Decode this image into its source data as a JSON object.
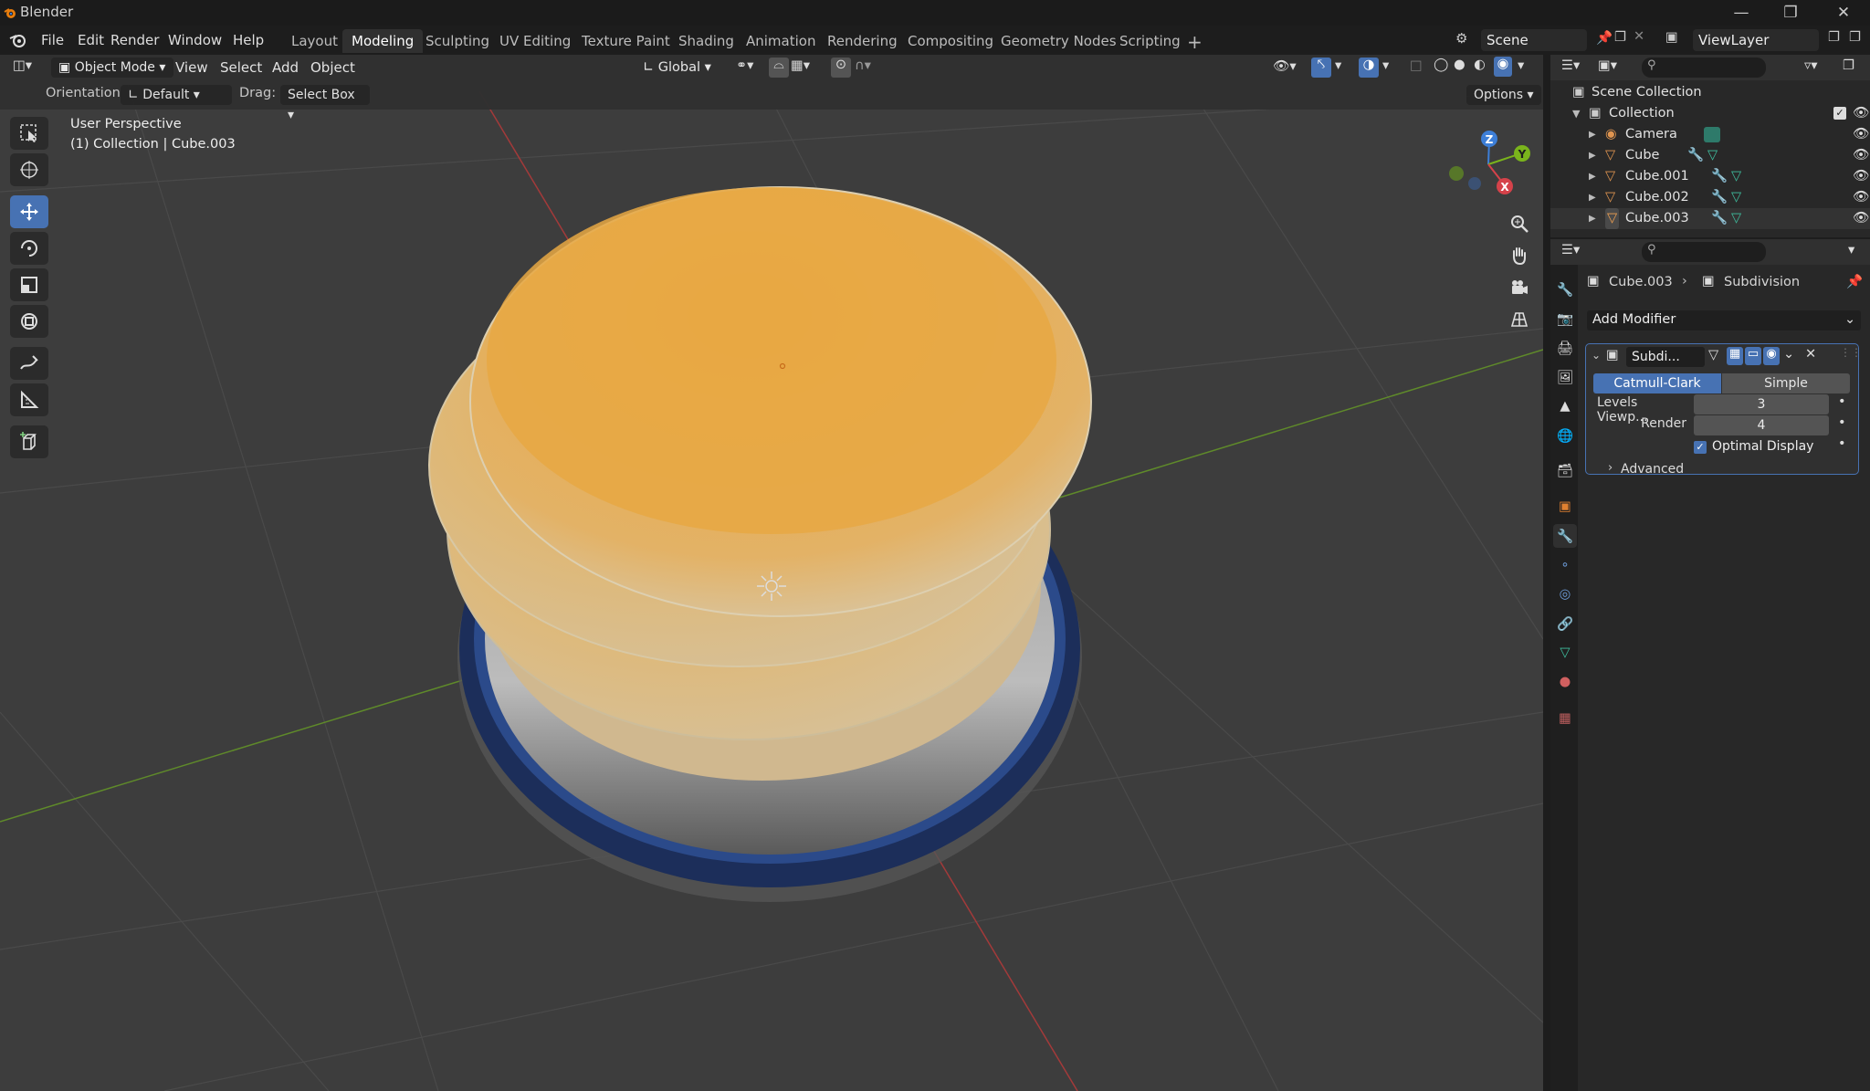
{
  "app": {
    "title": "Blender"
  },
  "menu": [
    "File",
    "Edit",
    "Render",
    "Window",
    "Help"
  ],
  "workspaces": [
    "Layout",
    "Modeling",
    "Sculpting",
    "UV Editing",
    "Texture Paint",
    "Shading",
    "Animation",
    "Rendering",
    "Compositing",
    "Geometry Nodes",
    "Scripting"
  ],
  "active_workspace": "Modeling",
  "scene": {
    "name": "Scene",
    "view_layer": "ViewLayer"
  },
  "viewport_header": {
    "mode": "Object Mode",
    "menus": [
      "View",
      "Select",
      "Add",
      "Object"
    ],
    "transform_orientation": "Global"
  },
  "tool_settings": {
    "orientation_label": "Orientation:",
    "orientation_value": "Default",
    "drag_label": "Drag:",
    "drag_value": "Select Box",
    "options": "Options"
  },
  "viewport_overlay": {
    "perspective": "User Perspective",
    "context": "(1) Collection | Cube.003"
  },
  "gizmo_axes": {
    "z": "Z",
    "y": "Y",
    "x": "X"
  },
  "outliner": {
    "root": "Scene Collection",
    "collection": "Collection",
    "items": [
      "Camera",
      "Cube",
      "Cube.001",
      "Cube.002",
      "Cube.003"
    ]
  },
  "properties": {
    "breadcrumb_object": "Cube.003",
    "breadcrumb_modifier": "Subdivision",
    "add_modifier": "Add Modifier",
    "modifier_name": "Subdi...",
    "mode_catmull": "Catmull-Clark",
    "mode_simple": "Simple",
    "levels_label": "Levels Viewp...",
    "levels_value": "3",
    "render_label": "Render",
    "render_value": "4",
    "optimal_display": "Optimal Display",
    "optimal_display_checked": true,
    "advanced": "Advanced"
  },
  "colors": {
    "accent": "#4772b3",
    "pancake": "#e8a842",
    "plate_rim": "#1f3668",
    "x_axis": "#d5424a",
    "y_axis": "#7ab41c"
  }
}
